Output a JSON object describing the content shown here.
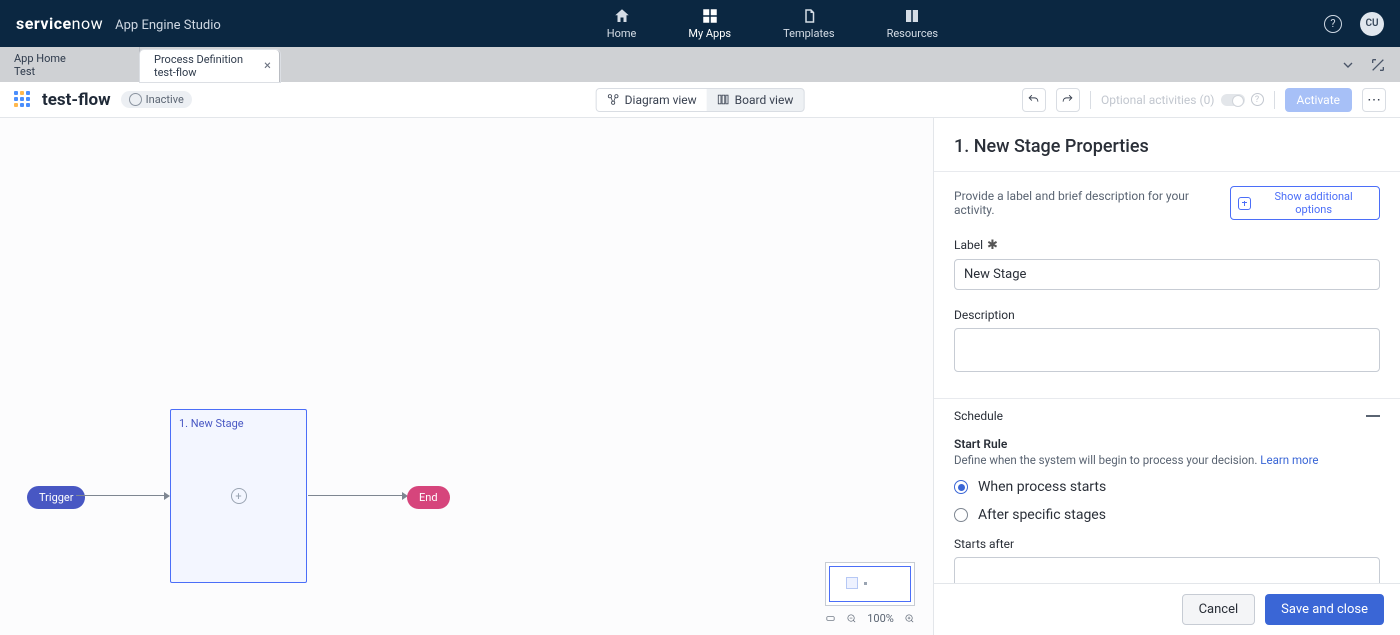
{
  "brand": {
    "logo_a": "service",
    "logo_b": "now",
    "product": "App Engine Studio"
  },
  "nav": {
    "items": [
      {
        "label": "Home"
      },
      {
        "label": "My Apps"
      },
      {
        "label": "Templates"
      },
      {
        "label": "Resources"
      }
    ],
    "avatar_initials": "CU"
  },
  "tabs": {
    "tab0": {
      "line1": "App Home",
      "line2": "Test"
    },
    "tab1": {
      "line1": "Process Definition",
      "line2": "test-flow"
    }
  },
  "toolbar": {
    "flow_name": "test-flow",
    "status": "Inactive",
    "view_diagram": "Diagram view",
    "view_board": "Board view",
    "optional_label": "Optional activities (0)",
    "activate": "Activate"
  },
  "diagram": {
    "trigger": "Trigger",
    "end": "End",
    "stage_label": "1. New Stage"
  },
  "zoom": {
    "percent": "100%"
  },
  "panel": {
    "title": "1. New Stage Properties",
    "help_text": "Provide a label and brief description for your activity.",
    "show_more": "Show additional options",
    "label_field_label": "Label",
    "label_field_value": "New Stage",
    "description_label": "Description",
    "description_value": "",
    "schedule_header": "Schedule",
    "start_rule_title": "Start Rule",
    "start_rule_desc": "Define when the system will begin to process your decision. ",
    "learn_more": "Learn more",
    "radio_when": "When process starts",
    "radio_after": "After specific stages",
    "starts_after_label": "Starts after",
    "starts_after_value": ""
  },
  "footer": {
    "cancel": "Cancel",
    "save": "Save and close"
  }
}
